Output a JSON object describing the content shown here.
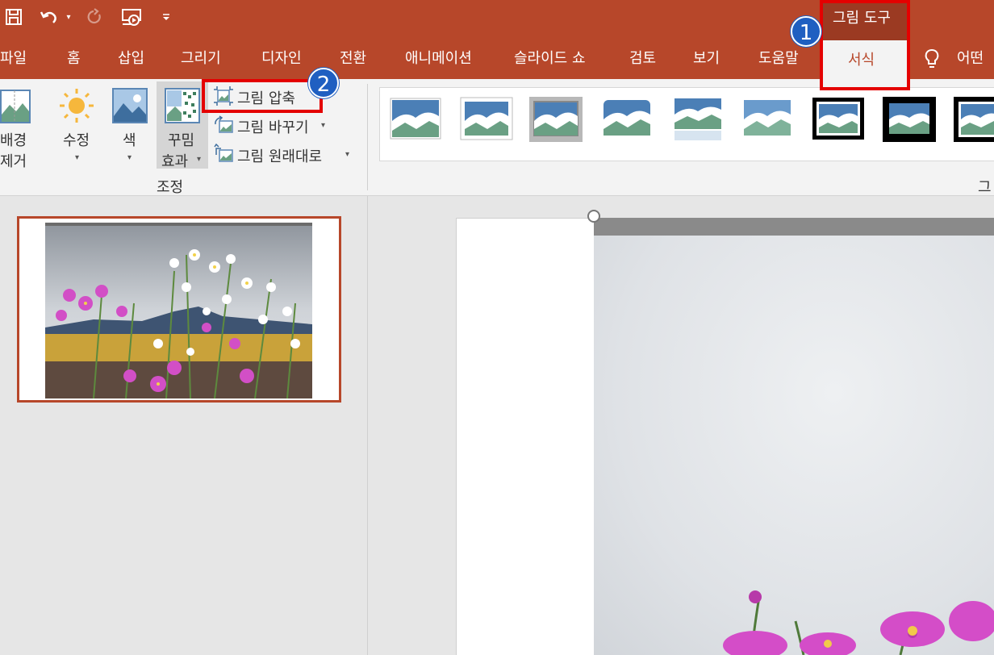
{
  "quick_access": {
    "save_icon": "save-icon",
    "undo_icon": "undo-icon",
    "redo_icon": "redo-icon",
    "present_icon": "present-from-start-icon",
    "customize_icon": "customize-qat-icon"
  },
  "context_tab_header": "그림 도구",
  "tabs": [
    "파일",
    "홈",
    "삽입",
    "그리기",
    "디자인",
    "전환",
    "애니메이션",
    "슬라이드 쇼",
    "검토",
    "보기",
    "도움말"
  ],
  "active_tab": "서식",
  "tell_me": "어떤",
  "ribbon": {
    "remove_bg": [
      "배경",
      "제거"
    ],
    "corrections": "수정",
    "color": "색",
    "artistic": [
      "꾸밈",
      "효과"
    ],
    "compress": "그림 압축",
    "change": "그림 바꾸기",
    "reset": "그림 원래대로",
    "adjust_group": "조정",
    "styles_group_partial": "그"
  },
  "annotations": {
    "step1": "1",
    "step2": "2"
  },
  "colors": {
    "accent": "#b7472a",
    "highlight": "#e40000",
    "badge": "#1f5fc1"
  }
}
